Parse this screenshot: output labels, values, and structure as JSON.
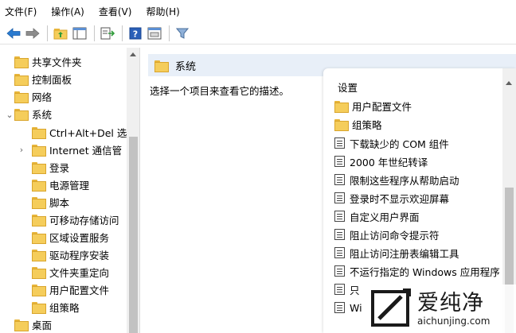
{
  "menu": [
    {
      "label": "文件(F)"
    },
    {
      "label": "操作(A)"
    },
    {
      "label": "查看(V)"
    },
    {
      "label": "帮助(H)"
    }
  ],
  "toolbar": {
    "icons": [
      "back-arrow-icon",
      "forward-arrow-icon",
      "up-folder-icon",
      "show-hide-tree-icon",
      "export-list-icon",
      "help-icon",
      "properties-icon",
      "filter-icon"
    ]
  },
  "tree": {
    "items": [
      {
        "label": "共享文件夹"
      },
      {
        "label": "控制面板"
      },
      {
        "label": "网络"
      },
      {
        "label": "系统"
      },
      {
        "label": "Ctrl+Alt+Del 选"
      },
      {
        "label": "Internet 通信管"
      },
      {
        "label": "登录"
      },
      {
        "label": "电源管理"
      },
      {
        "label": "脚本"
      },
      {
        "label": "可移动存储访问"
      },
      {
        "label": "区域设置服务"
      },
      {
        "label": "驱动程序安装"
      },
      {
        "label": "文件夹重定向"
      },
      {
        "label": "用户配置文件"
      },
      {
        "label": "组策略"
      },
      {
        "label": "桌面"
      }
    ]
  },
  "right": {
    "header_title": "系统",
    "description": "选择一个项目来查看它的描述。"
  },
  "list": {
    "header": "设置",
    "items": [
      {
        "label": "用户配置文件",
        "icon": "folder"
      },
      {
        "label": "组策略",
        "icon": "folder"
      },
      {
        "label": "下载缺少的 COM 组件",
        "icon": "setting"
      },
      {
        "label": "2000 年世纪转译",
        "icon": "setting"
      },
      {
        "label": "限制这些程序从帮助启动",
        "icon": "setting"
      },
      {
        "label": "登录时不显示欢迎屏幕",
        "icon": "setting"
      },
      {
        "label": "自定义用户界面",
        "icon": "setting"
      },
      {
        "label": "阻止访问命令提示符",
        "icon": "setting"
      },
      {
        "label": "阻止访问注册表编辑工具",
        "icon": "setting"
      },
      {
        "label": "不运行指定的 Windows 应用程序",
        "icon": "setting"
      },
      {
        "label": "只",
        "icon": "setting"
      },
      {
        "label": "Wi",
        "icon": "setting"
      }
    ]
  },
  "watermark": {
    "cn": "爱纯净",
    "url": "aichunjing.com"
  },
  "colors": {
    "header_bg": "#e8eff8",
    "folder": "#f5cd5b",
    "toolbar_blue": "#1f6fbf"
  }
}
